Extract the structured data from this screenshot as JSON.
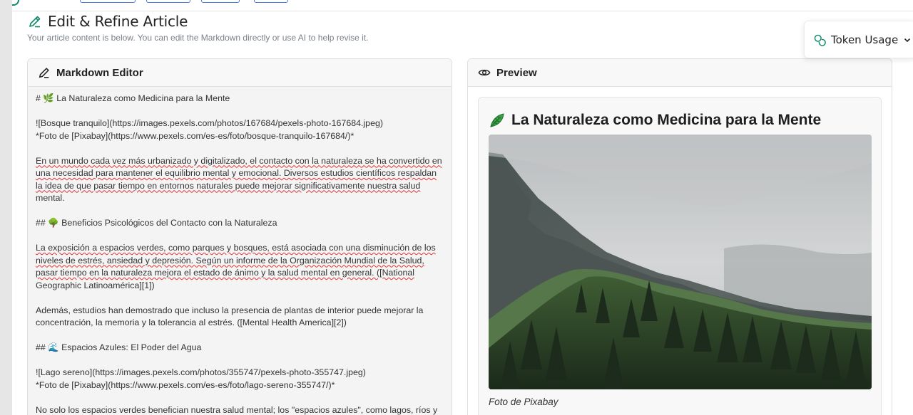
{
  "header": {
    "title": "Edit & Refine Article",
    "subtitle": "Your article content is below. You can edit the Markdown directly or use AI to help revise it."
  },
  "token_usage": {
    "label": "Token Usage"
  },
  "editor": {
    "title": "Markdown Editor",
    "lines": {
      "l1": "# 🌿 La Naturaleza como Medicina para la Mente",
      "l2": "![Bosque tranquilo](https://images.pexels.com/photos/167684/pexels-photo-167684.jpeg)",
      "l3": "*Foto de [Pixabay](https://www.pexels.com/es-es/foto/bosque-tranquilo-167684/)*",
      "l4": "En un mundo cada vez más urbanizado y digitalizado, el contacto con la naturaleza se ha convertido en",
      "l5": "una necesidad para mantener el equilibrio mental y emocional. Diversos estudios científicos respaldan",
      "l6": "la idea de que pasar tiempo en entornos naturales puede mejorar significativamente nuestra salud",
      "l7": "mental.",
      "l8": "## 🌳 Beneficios Psicológicos del Contacto con la Naturaleza",
      "l9": "La exposición a espacios verdes, como parques y bosques, está asociada con una disminución de los",
      "l10": "niveles de estrés, ansiedad y depresión. Según un informe de la Organización Mundial de la Salud,",
      "l11": "pasar tiempo en la naturaleza mejora el estado de ánimo y la salud mental en general. ([National",
      "l12": "Geographic Latinoamérica][1])",
      "l13": "Además, estudios han demostrado que incluso la presencia de plantas de interior puede mejorar la",
      "l14": "concentración, la memoria y la tolerancia al estrés. ([Mental Health America][2])",
      "l15": "## 🌊 Espacios Azules: El Poder del Agua",
      "l16": "![Lago sereno](https://images.pexels.com/photos/355747/pexels-photo-355747.jpeg)",
      "l17": "*Foto de [Pixabay](https://www.pexels.com/es-es/foto/lago-sereno-355747/)*",
      "l18": "No solo los espacios verdes benefician nuestra salud mental; los \"espacios azules\", como lagos, ríos y"
    }
  },
  "preview": {
    "title": "Preview",
    "article_title": "La Naturaleza como Medicina para la Mente",
    "caption": "Foto de Pixabay"
  },
  "colors": {
    "accent_green": "#0d8a6a",
    "spell_error": "#e03131",
    "leaf": "#3aa34a"
  }
}
